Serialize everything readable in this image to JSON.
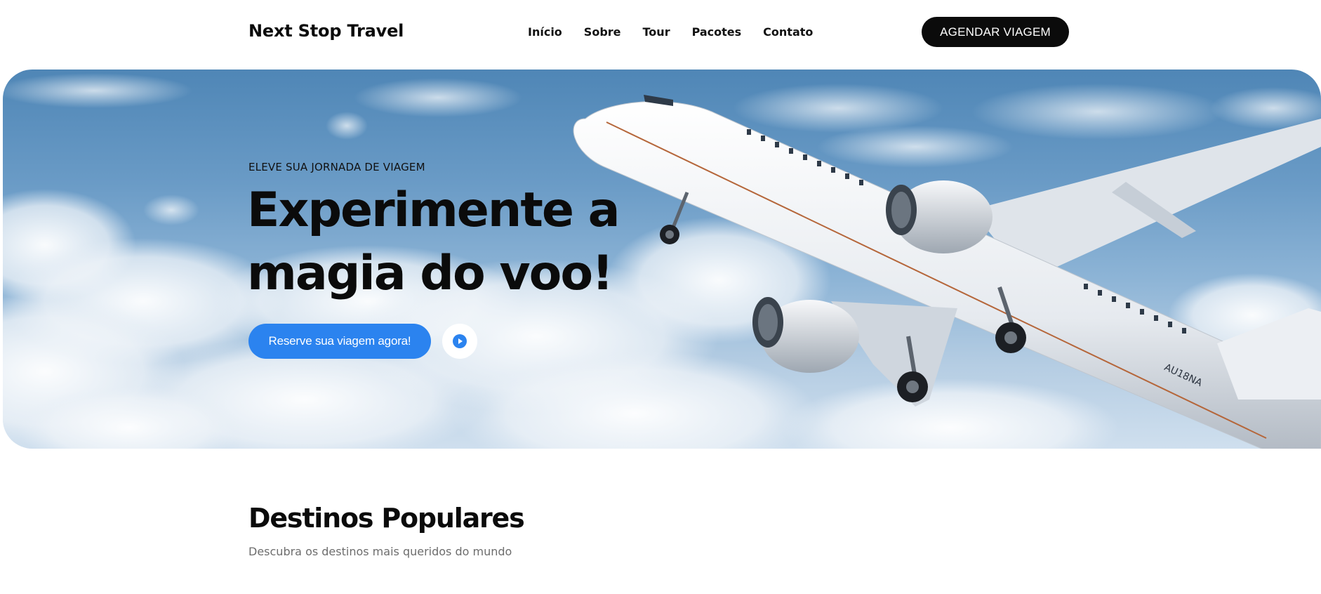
{
  "header": {
    "brand": "Next Stop Travel",
    "nav": [
      {
        "label": "Início"
      },
      {
        "label": "Sobre"
      },
      {
        "label": "Tour"
      },
      {
        "label": "Pacotes"
      },
      {
        "label": "Contato"
      }
    ],
    "cta_label": "AGENDAR VIAGEM"
  },
  "hero": {
    "eyebrow": "ELEVE SUA JORNADA DE VIAGEM",
    "headline_line1": "Experimente a",
    "headline_line2": "magia do voo!",
    "cta_label": "Reserve sua viagem agora!",
    "play_icon": "play-icon",
    "image": "airplane-taking-off-in-cloudy-sky",
    "plane_registration": "AU18NA"
  },
  "destinations": {
    "title": "Destinos Populares",
    "subtitle": "Descubra os destinos mais queridos do mundo"
  },
  "colors": {
    "accent": "#2b83ef",
    "dark": "#0b0b0b",
    "muted": "#6d6d6d",
    "sky": "#5b8fbd"
  }
}
